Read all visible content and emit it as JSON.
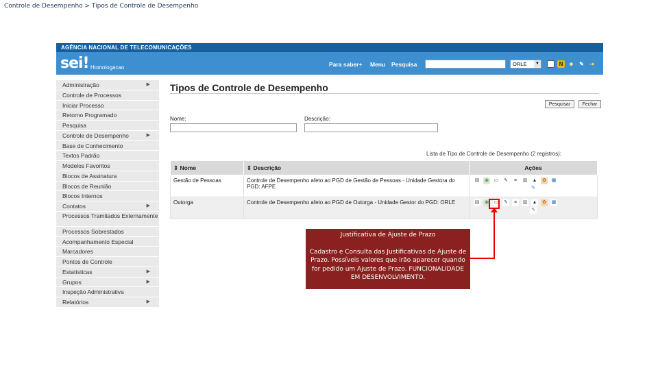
{
  "breadcrumb": "Controle de Desempenho > Tipos de Controle de Desempenho",
  "agency": "AGÊNCIA NACIONAL DE TELECOMUNICAÇÕES",
  "logo": "sei!",
  "environment": "Homologacao",
  "header_nav": {
    "para_saber": "Para saber+",
    "menu": "Menu",
    "pesquisa": "Pesquisa"
  },
  "unit_select": "ORLE",
  "sidebar": [
    {
      "label": "Administração",
      "submenu": true
    },
    {
      "label": "Controle de Processos",
      "submenu": false
    },
    {
      "label": "Iniciar Processo",
      "submenu": false
    },
    {
      "label": "Retorno Programado",
      "submenu": false
    },
    {
      "label": "Pesquisa",
      "submenu": false
    },
    {
      "label": "Controle de Desempenho",
      "submenu": true
    },
    {
      "label": "Base de Conhecimento",
      "submenu": false
    },
    {
      "label": "Textos Padrão",
      "submenu": false
    },
    {
      "label": "Modelos Favoritos",
      "submenu": false
    },
    {
      "label": "Blocos de Assinatura",
      "submenu": false
    },
    {
      "label": "Blocos de Reunião",
      "submenu": false
    },
    {
      "label": "Blocos Internos",
      "submenu": false
    },
    {
      "label": "Contatos",
      "submenu": true
    },
    {
      "label": "Processos Tramitados Externamente",
      "submenu": false
    },
    {
      "label": "Processos Sobrestados",
      "submenu": false
    },
    {
      "label": "Acompanhamento Especial",
      "submenu": false
    },
    {
      "label": "Marcadores",
      "submenu": false
    },
    {
      "label": "Pontos de Controle",
      "submenu": false
    },
    {
      "label": "Estatísticas",
      "submenu": true
    },
    {
      "label": "Grupos",
      "submenu": true
    },
    {
      "label": "Inspeção Administrativa",
      "submenu": false
    },
    {
      "label": "Relatórios",
      "submenu": true
    }
  ],
  "page_title": "Tipos de Controle de Desempenho",
  "buttons": {
    "pesquisar": "Pesquisar",
    "fechar": "Fechar"
  },
  "filters": {
    "nome_label": "Nome:",
    "descricao_label": "Descrição:"
  },
  "table": {
    "caption": "Lista de Tipo de Controle de Desempenho (2 registros):",
    "headers": {
      "nome": "Nome",
      "descricao": "Descrição",
      "acoes": "Ações"
    },
    "rows": [
      {
        "nome": "Gestão de Pessoas",
        "descricao": "Controle de Desempenho afeto ao PGD de Gestão de Pessoas - Unidade Gestora do PGD: AFPE"
      },
      {
        "nome": "Outorga",
        "descricao": "Controle de Desempenho afeto ao PGD de Outorga - Unidade Gestor do PGD: ORLE"
      }
    ]
  },
  "callout": {
    "title": "Justificativa de Ajuste de Prazo",
    "body": "Cadastro e Consulta das Justificativas de Ajuste de Prazo. Possíveis valores que irão aparecer quando for pedido um Ajuste de Prazo. FUNCIONALIDADE EM DESENVOLVIMENTO."
  },
  "action_icons": [
    "document-icon",
    "justificativa-icon",
    "monitor-icon",
    "edit-icon",
    "list-icon",
    "page-icon",
    "stamp-icon",
    "gear-icon",
    "chart-icon",
    "note-icon"
  ],
  "colors": {
    "header_dark": "#155f9e",
    "header": "#3d8fd0",
    "callout": "#8a2020",
    "highlight": "#e00000"
  }
}
